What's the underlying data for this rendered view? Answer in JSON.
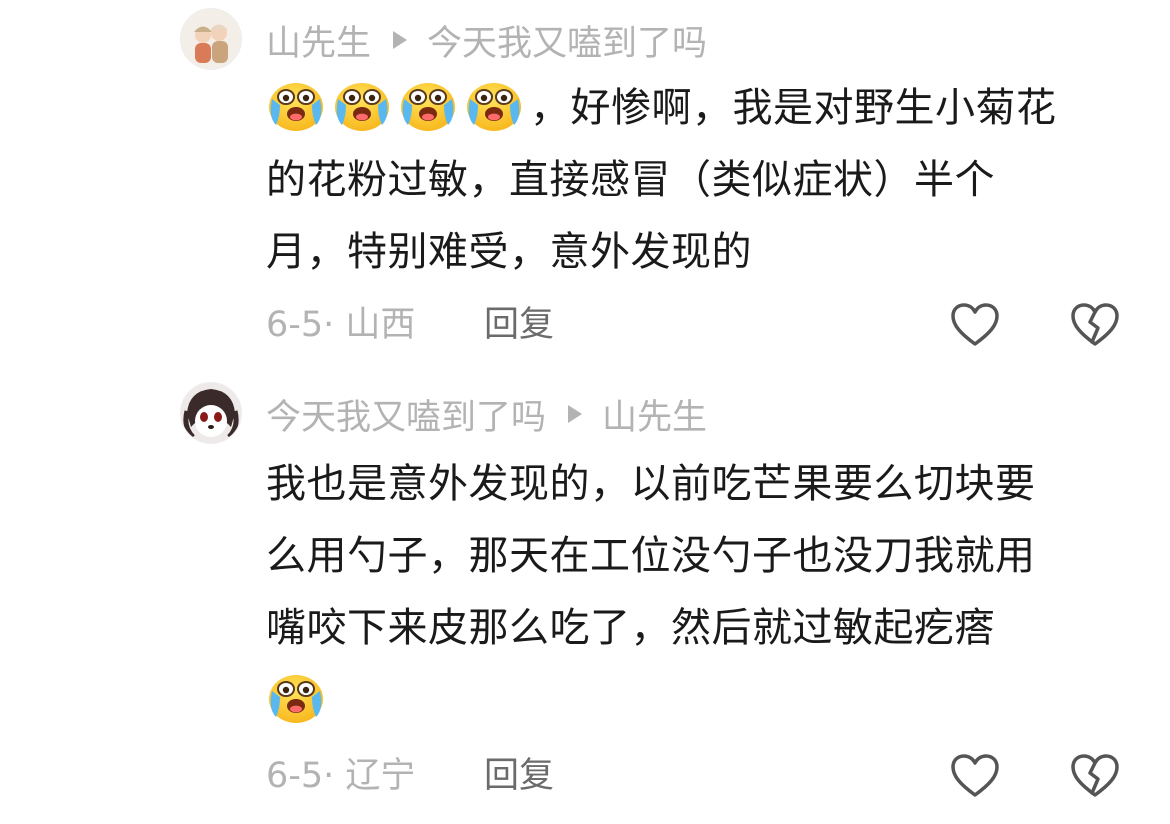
{
  "comments": [
    {
      "author": "山先生",
      "reply_to": "今天我又嗑到了吗",
      "emoji_icon": "crying-emoji-icon",
      "emoji_count": 4,
      "lines": [
        "，好惨啊，我是对野生小菊花",
        "的花粉过敏，直接感冒（类似症状）半个",
        "月，特别难受，意外发现的"
      ],
      "date_location": "6-5· 山西",
      "reply_label": "回复"
    },
    {
      "author": "今天我又嗑到了吗",
      "reply_to": "山先生",
      "emoji_icon": "crying-emoji-icon",
      "lines": [
        "我也是意外发现的，以前吃芒果要么切块要",
        "么用勺子，那天在工位没勺子也没刀我就用",
        "嘴咬下来皮那么吃了，然后就过敏起疙瘩"
      ],
      "date_location": "6-5· 辽宁",
      "reply_label": "回复"
    }
  ],
  "colors": {
    "text": "#1a1a1a",
    "meta": "#b3b3b3",
    "reply": "#6b6b6b",
    "icon": "#555555"
  }
}
